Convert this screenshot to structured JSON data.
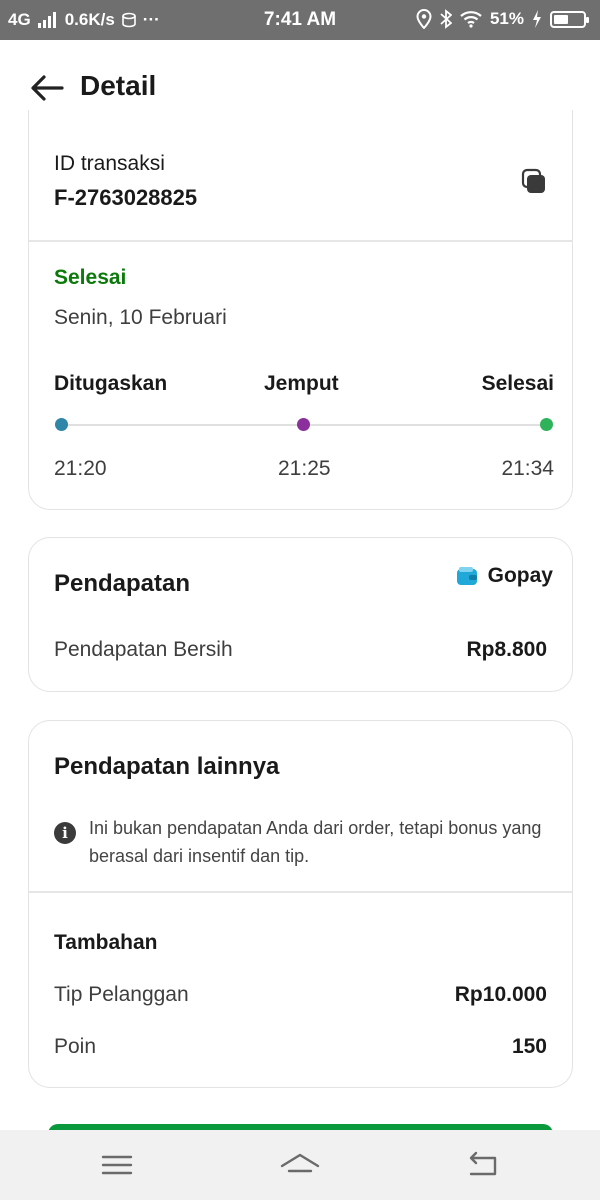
{
  "status_bar": {
    "network": "4G",
    "speed": "0.6K/s",
    "more": "···",
    "time": "7:41 AM",
    "battery_percent": "51%",
    "battery_level": 0.51
  },
  "header": {
    "title": "Detail"
  },
  "transaction": {
    "id_label": "ID transaksi",
    "id_value": "F-2763028825",
    "status": "Selesai",
    "date": "Senin, 10 Februari",
    "timeline": [
      {
        "label": "Ditugaskan",
        "time": "21:20",
        "color": "#2e86a8"
      },
      {
        "label": "Jemput",
        "time": "21:25",
        "color": "#8a2f9c"
      },
      {
        "label": "Selesai",
        "time": "21:34",
        "color": "#2fb35a"
      }
    ]
  },
  "earnings": {
    "title": "Pendapatan",
    "wallet": "Gopay",
    "net_label": "Pendapatan Bersih",
    "net_value": "Rp8.800"
  },
  "other_earnings": {
    "title": "Pendapatan lainnya",
    "info": "Ini bukan pendapatan Anda dari order, tetapi bonus yang berasal dari insentif dan tip.",
    "subtitle": "Tambahan",
    "rows": [
      {
        "label": "Tip Pelanggan",
        "value": "Rp10.000"
      },
      {
        "label": "Poin",
        "value": "150"
      }
    ]
  },
  "icons": {
    "back": "arrow-left-icon",
    "copy": "copy-icon",
    "wallet": "wallet-icon",
    "info": "info-icon",
    "menu": "menu-icon",
    "home": "home-icon",
    "return": "back-icon"
  },
  "colors": {
    "status_green": "#0b7a0b",
    "wallet_blue": "#1fa8d8",
    "button_green": "#0a9a3d"
  }
}
